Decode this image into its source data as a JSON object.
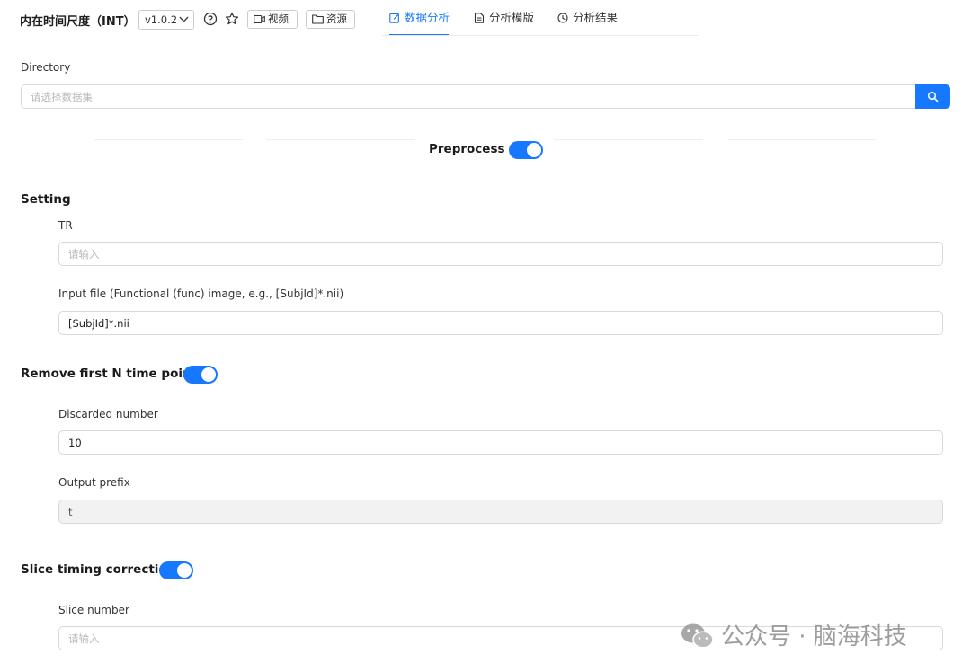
{
  "header": {
    "app_title": "内在时间尺度（INT）",
    "version": "v1.0.2",
    "video_label": "视频",
    "resource_label": "资源",
    "tabs": [
      {
        "label": "数据分析",
        "active": true,
        "icon": "edit-icon"
      },
      {
        "label": "分析模版",
        "active": false,
        "icon": "file-icon"
      },
      {
        "label": "分析结果",
        "active": false,
        "icon": "history-icon"
      }
    ]
  },
  "directory": {
    "label": "Directory",
    "placeholder": "请选择数据集"
  },
  "preprocess": {
    "label": "Preprocess",
    "enabled": true
  },
  "setting": {
    "title": "Setting",
    "tr_label": "TR",
    "tr_placeholder": "请输入",
    "input_file_label": "Input file (Functional (func) image, e.g., [SubjId]*.nii)",
    "input_file_value": "[SubjId]*.nii"
  },
  "remove_first": {
    "title": "Remove first N time points",
    "enabled": true,
    "discarded_label": "Discarded number",
    "discarded_value": "10",
    "prefix_label": "Output prefix",
    "prefix_value": "t"
  },
  "slice_timing": {
    "title": "Slice timing correction",
    "enabled": true,
    "slice_number_label": "Slice number",
    "slice_number_placeholder": "请输入"
  },
  "watermark": {
    "text": "公众号 · 脑海科技",
    "icon": "wechat-icon"
  },
  "colors": {
    "accent": "#1677ff",
    "border": "#d9d9d9",
    "disabled_bg": "#f2f2f2"
  }
}
